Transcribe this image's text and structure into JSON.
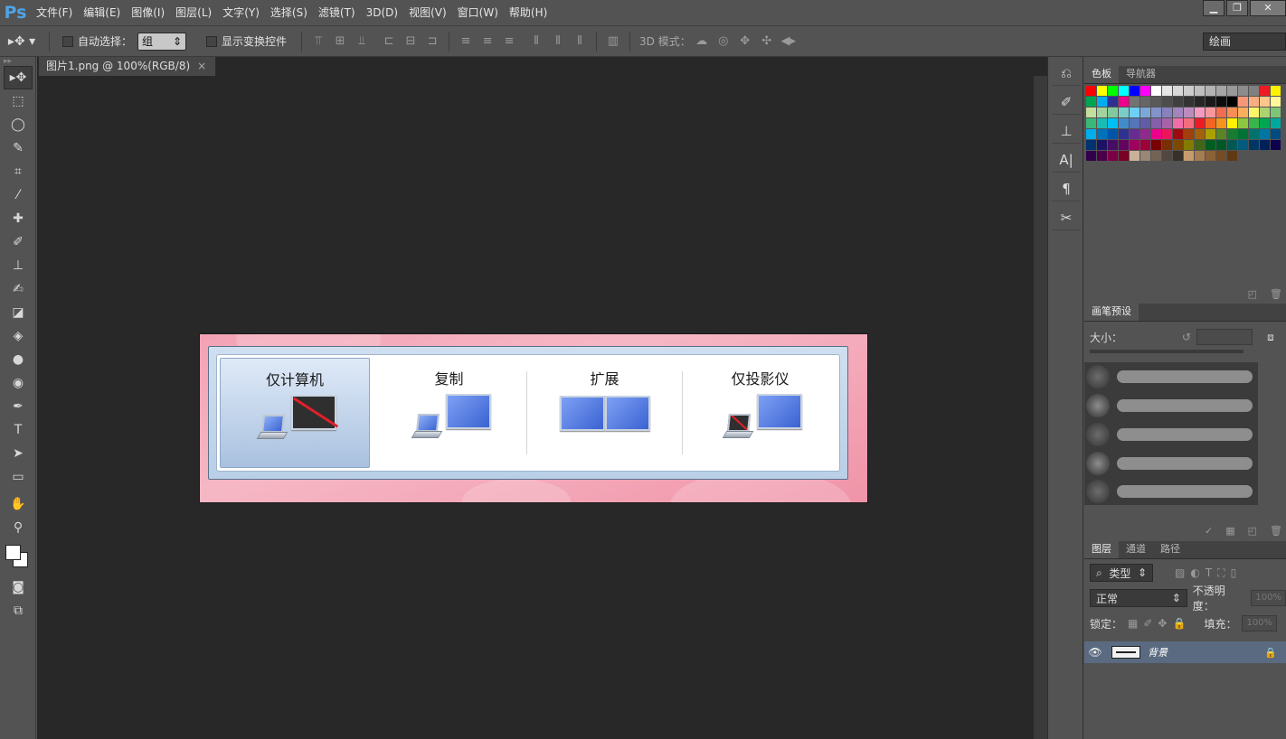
{
  "app": {
    "logo": "Ps"
  },
  "menu": [
    "文件(F)",
    "编辑(E)",
    "图像(I)",
    "图层(L)",
    "文字(Y)",
    "选择(S)",
    "滤镜(T)",
    "3D(D)",
    "视图(V)",
    "窗口(W)",
    "帮助(H)"
  ],
  "window_controls": {
    "minimize": "▁",
    "restore": "❐",
    "close": "✕"
  },
  "options_bar": {
    "auto_select_label": "自动选择：",
    "auto_select_value": "组",
    "show_transform_label": "显示变换控件",
    "mode_3d_label": "3D 模式：",
    "workspace": "绘画"
  },
  "document": {
    "tab_title": "图片1.png @ 100%(RGB/8)",
    "tab_close": "×"
  },
  "projection_dialog": {
    "options": [
      "仅计算机",
      "复制",
      "扩展",
      "仅投影仪"
    ],
    "selected_index": 0
  },
  "panels": {
    "swatches_tabs": [
      "色板",
      "导航器"
    ],
    "brush_presets_tab": "画笔预设",
    "size_label": "大小：",
    "layers_tabs": [
      "图层",
      "通道",
      "路径"
    ],
    "filter_type": "类型",
    "blend_mode": "正常",
    "opacity_label": "不透明度：",
    "opacity_value": "100%",
    "lock_label": "锁定：",
    "fill_label": "填充：",
    "fill_value": "100%",
    "layer_name": "背景"
  },
  "colors": {
    "swatches": [
      "#ff0000",
      "#ffff00",
      "#00ff00",
      "#00ffff",
      "#0000ff",
      "#ff00ff",
      "#ffffff",
      "#e6e6e6",
      "#d9d9d9",
      "#cccccc",
      "#bfbfbf",
      "#b3b3b3",
      "#a6a6a6",
      "#999999",
      "#8c8c8c",
      "#808080",
      "#ed1c24",
      "#fff200",
      "#00a651",
      "#00aeef",
      "#2e3192",
      "#ec008c",
      "#737373",
      "#666666",
      "#595959",
      "#4d4d4d",
      "#404040",
      "#333333",
      "#262626",
      "#1a1a1a",
      "#0d0d0d",
      "#000000",
      "#f7977a",
      "#f9ad81",
      "#fdc68a",
      "#fff79a",
      "#c4df9b",
      "#a3d39c",
      "#82ca9d",
      "#7accc8",
      "#6dcff6",
      "#7da7d9",
      "#8393ca",
      "#8781bd",
      "#a186be",
      "#bd8cbf",
      "#f49ac1",
      "#f5989d",
      "#f26c4f",
      "#f68e56",
      "#fbaf5d",
      "#fff568",
      "#acd372",
      "#7cc576",
      "#3bb878",
      "#1abbb4",
      "#00bff3",
      "#438ccb",
      "#5574b9",
      "#605ca8",
      "#855fa8",
      "#a763a8",
      "#f06eaa",
      "#f26d7d",
      "#ed1c24",
      "#f26522",
      "#f7941d",
      "#fff200",
      "#8dc63f",
      "#39b54a",
      "#00a651",
      "#00a99d",
      "#00aeef",
      "#0072bc",
      "#0054a6",
      "#2e3192",
      "#662d91",
      "#92278f",
      "#ec008c",
      "#ed145b",
      "#9e0b0f",
      "#a0410d",
      "#a3620a",
      "#aba000",
      "#598527",
      "#197b30",
      "#007236",
      "#00746b",
      "#0076a3",
      "#004b80",
      "#003471",
      "#1b1464",
      "#440e62",
      "#630460",
      "#9e005d",
      "#9e0039",
      "#790000",
      "#7b2e00",
      "#7d4900",
      "#827b00",
      "#406618",
      "#005e20",
      "#005826",
      "#005952",
      "#005b7f",
      "#003663",
      "#002157",
      "#0d004c",
      "#32004b",
      "#4b0049",
      "#7b0046",
      "#7a0026",
      "#c7b299",
      "#998675",
      "#736357",
      "#534741",
      "#37302a",
      "#c69c6d",
      "#a67c52",
      "#8c6239",
      "#754c24",
      "#603913"
    ]
  }
}
